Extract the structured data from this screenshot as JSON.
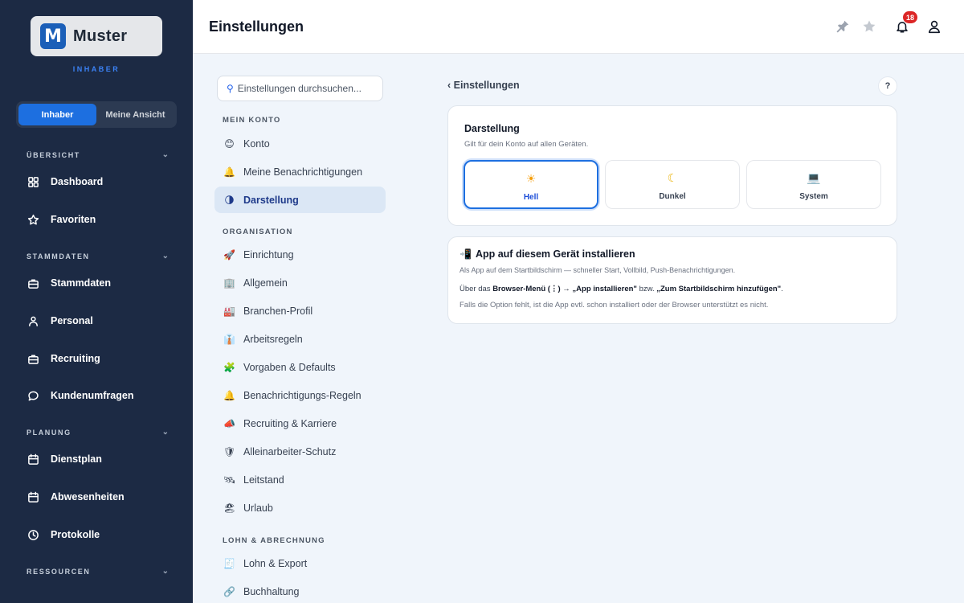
{
  "sidebar": {
    "logo_letter": "M",
    "logo_text": "Muster",
    "role": "INHABER",
    "toggle": [
      "Inhaber",
      "Meine Ansicht"
    ],
    "sections": {
      "uebersicht": "ÜBERSICHT",
      "stammdaten": "STAMMDATEN",
      "planung": "PLANUNG",
      "ressourcen": "RESSOURCEN"
    },
    "items": {
      "dashboard": "Dashboard",
      "favoriten": "Favoriten",
      "stammdaten": "Stammdaten",
      "personal": "Personal",
      "recruiting": "Recruiting",
      "kundenumfragen": "Kundenumfragen",
      "dienstplan": "Dienstplan",
      "abwesenheiten": "Abwesenheiten",
      "protokolle": "Protokolle"
    }
  },
  "header": {
    "title": "Einstellungen",
    "notification_count": "18",
    "icons": [
      "pin-icon",
      "star-icon",
      "bell-icon",
      "user-icon"
    ]
  },
  "settings_nav": {
    "search_placeholder": "Einstellungen durchsuchen...",
    "sections": {
      "mein_konto": "MEIN KONTO",
      "organisation": "ORGANISATION",
      "lohn": "LOHN & ABRECHNUNG"
    },
    "items": [
      {
        "emoji": "😊",
        "label": "Konto"
      },
      {
        "emoji": "🔔",
        "label": "Meine Benachrichtigungen"
      },
      {
        "emoji": "🌗",
        "label": "Darstellung",
        "active": true
      },
      {
        "emoji": "🚀",
        "label": "Einrichtung"
      },
      {
        "emoji": "🏢",
        "label": "Allgemein"
      },
      {
        "emoji": "🏭",
        "label": "Branchen-Profil"
      },
      {
        "emoji": "👔",
        "label": "Arbeitsregeln"
      },
      {
        "emoji": "🧩",
        "label": "Vorgaben & Defaults"
      },
      {
        "emoji": "🔔",
        "label": "Benachrichtigungs-Regeln"
      },
      {
        "emoji": "📣",
        "label": "Recruiting & Karriere"
      },
      {
        "emoji": "🛡",
        "label": "Alleinarbeiter-Schutz"
      },
      {
        "emoji": "🛰",
        "label": "Leitstand"
      },
      {
        "emoji": "🏖",
        "label": "Urlaub"
      },
      {
        "emoji": "🧾",
        "label": "Lohn & Export"
      },
      {
        "emoji": "🔗",
        "label": "Buchhaltung"
      }
    ]
  },
  "main": {
    "back": "‹ Einstellungen",
    "help": "?",
    "appearance": {
      "title": "Darstellung",
      "subtitle": "Gilt für dein Konto auf allen Geräten.",
      "options": [
        {
          "icon": "☀",
          "label": "Hell",
          "selected": true
        },
        {
          "icon": "☾",
          "label": "Dunkel"
        },
        {
          "icon": "💻",
          "label": "System"
        }
      ]
    },
    "install": {
      "icon": "📲",
      "title": "App auf diesem Gerät installieren",
      "subtitle": "Als App auf dem Startbildschirm — schneller Start, Vollbild, Push-Benachrichtigungen.",
      "line_a": "Über das ",
      "line_b": "Browser-Menü (⋮) → „App installieren\"",
      "line_c": " bzw. ",
      "line_d": "„Zum Startbildschirm hinzufügen\"",
      "line_e": ".",
      "note": "Falls die Option fehlt, ist die App evtl. schon installiert oder der Browser unterstützt es nicht."
    }
  },
  "colors": {
    "sidebar_bg": "#1c2a44",
    "accent": "#1d6fe0",
    "badge": "#dc2626",
    "active_item_bg": "#dbe7f5"
  }
}
